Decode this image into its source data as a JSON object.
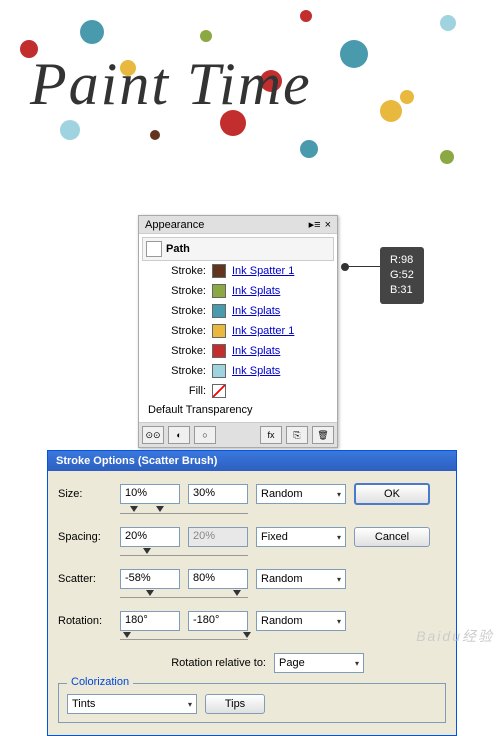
{
  "artwork": {
    "text": "Paint Time"
  },
  "appearance": {
    "tab": "Appearance",
    "close_x": "×",
    "path_label": "Path",
    "rows": [
      {
        "label": "Stroke:",
        "color": "#62341f",
        "link": "Ink Spatter 1"
      },
      {
        "label": "Stroke:",
        "color": "#8ca843",
        "link": "Ink Splats"
      },
      {
        "label": "Stroke:",
        "color": "#4a9aad",
        "link": "Ink Splats"
      },
      {
        "label": "Stroke:",
        "color": "#e8b93e",
        "link": "Ink Spatter 1"
      },
      {
        "label": "Stroke:",
        "color": "#c22e2e",
        "link": "Ink Splats"
      },
      {
        "label": "Stroke:",
        "color": "#9fd3e0",
        "link": "Ink Splats"
      },
      {
        "label": "Fill:",
        "color": "none",
        "link": ""
      }
    ],
    "default_transparency": "Default Transparency",
    "footer_icons": [
      "⊙⊙",
      "◐",
      "○",
      "fx",
      "⎘",
      "🗑"
    ]
  },
  "rgb": {
    "r": "R:98",
    "g": "G:52",
    "b": "B:31"
  },
  "dialog": {
    "title": "Stroke Options (Scatter Brush)",
    "labels": {
      "size": "Size:",
      "spacing": "Spacing:",
      "scatter": "Scatter:",
      "rotation": "Rotation:",
      "rotrel": "Rotation relative to:"
    },
    "size": {
      "v1": "10%",
      "v2": "30%",
      "mode": "Random"
    },
    "spacing": {
      "v1": "20%",
      "v2": "20%",
      "mode": "Fixed"
    },
    "scatter": {
      "v1": "-58%",
      "v2": "80%",
      "mode": "Random"
    },
    "rotation": {
      "v1": "180°",
      "v2": "-180°",
      "mode": "Random"
    },
    "rotrel_value": "Page",
    "colorization": {
      "label": "Colorization",
      "value": "Tints",
      "tips": "Tips"
    },
    "ok": "OK",
    "cancel": "Cancel"
  },
  "watermark": "Baidu经验"
}
